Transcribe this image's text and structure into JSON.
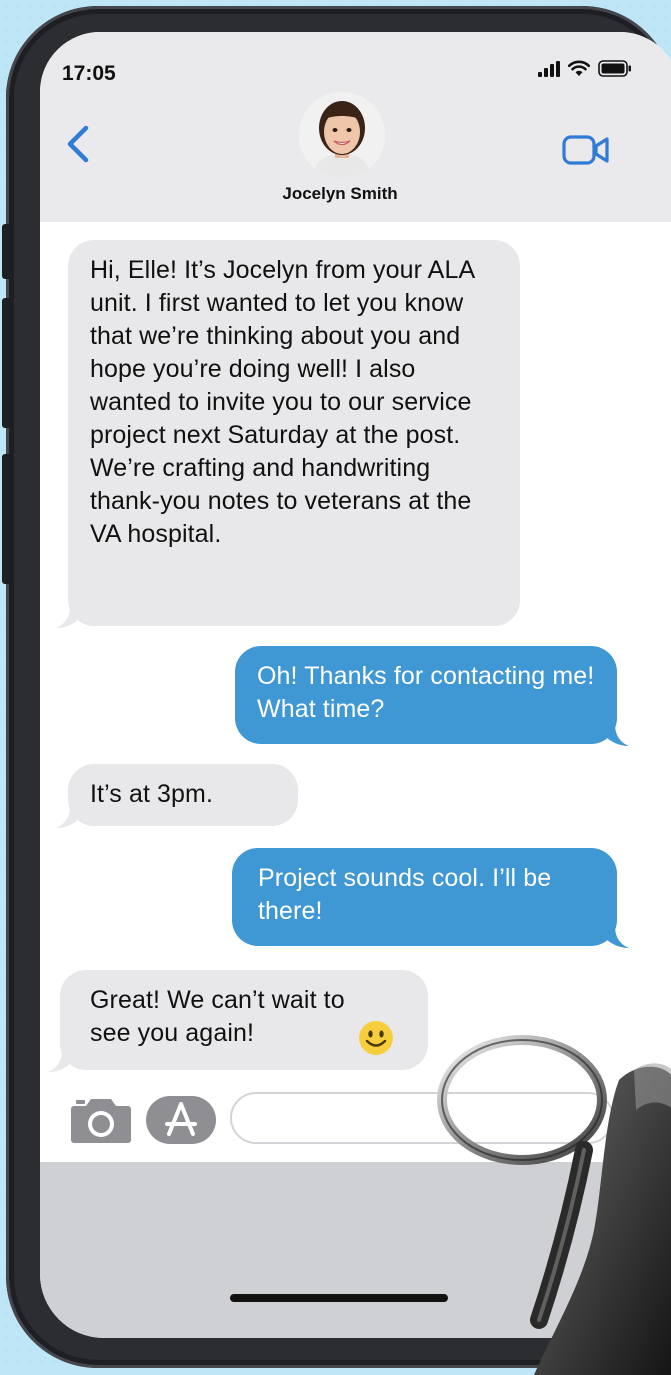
{
  "status_bar": {
    "time": "17:05"
  },
  "header": {
    "contact_name": "Jocelyn Smith"
  },
  "messages": [
    {
      "sender": "contact",
      "text": "Hi, Elle! It’s Jocelyn from your ALA unit. I first wanted to let you know that we’re thinking about you and hope you’re doing well! I also wanted to invite you to our service project next Saturday at the post. We’re crafting and handwriting thank-you notes to veterans at the VA hospital."
    },
    {
      "sender": "me",
      "text": "Oh! Thanks for contacting me! What time?"
    },
    {
      "sender": "contact",
      "text": "It’s at 3pm."
    },
    {
      "sender": "me",
      "text": "Project sounds cool. I’ll be there!"
    },
    {
      "sender": "contact",
      "text": "Great! We can’t wait to see you again!"
    }
  ],
  "input": {
    "placeholder": ""
  },
  "colors": {
    "outgoing_bubble": "#3f97d3",
    "incoming_bubble": "#e8e8ea",
    "accent": "#2f7bd6"
  },
  "icons": [
    "back-icon",
    "video-icon",
    "camera-icon",
    "appstore-icon",
    "smiley-emoji"
  ]
}
